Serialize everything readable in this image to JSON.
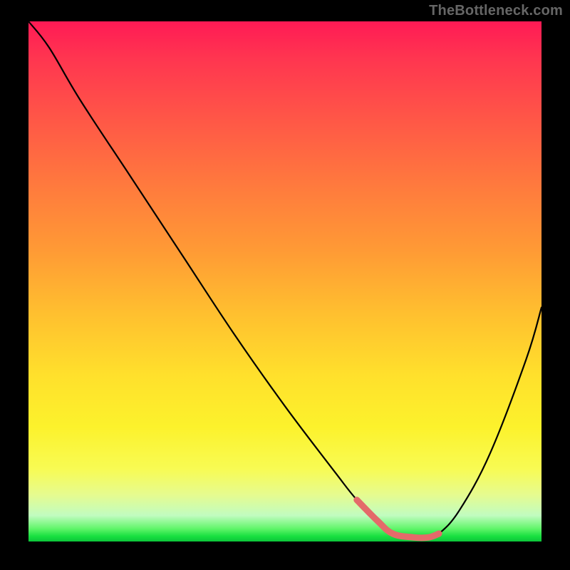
{
  "watermark": "TheBottleneck.com",
  "colors": {
    "page_bg": "#000000",
    "watermark": "#666666",
    "curve_black": "#000000",
    "highlight": "#e46a6a"
  },
  "chart_data": {
    "type": "line",
    "title": "",
    "xlabel": "",
    "ylabel": "",
    "xlim": [
      0,
      100
    ],
    "ylim": [
      0,
      100
    ],
    "grid": false,
    "legend": false,
    "series": [
      {
        "name": "main-curve",
        "x": [
          0,
          4,
          10,
          20,
          30,
          40,
          50,
          60,
          64,
          68,
          71,
          75,
          78,
          80,
          84,
          90,
          97,
          100
        ],
        "y": [
          100,
          95,
          85,
          70,
          55,
          40,
          26,
          13,
          8,
          4,
          1.5,
          0.8,
          0.8,
          1.5,
          6,
          17,
          35,
          45
        ]
      },
      {
        "name": "highlight-segment",
        "x": [
          64,
          68,
          71,
          75,
          78,
          80
        ],
        "y": [
          8,
          4,
          1.5,
          0.8,
          0.8,
          1.5
        ]
      }
    ]
  }
}
